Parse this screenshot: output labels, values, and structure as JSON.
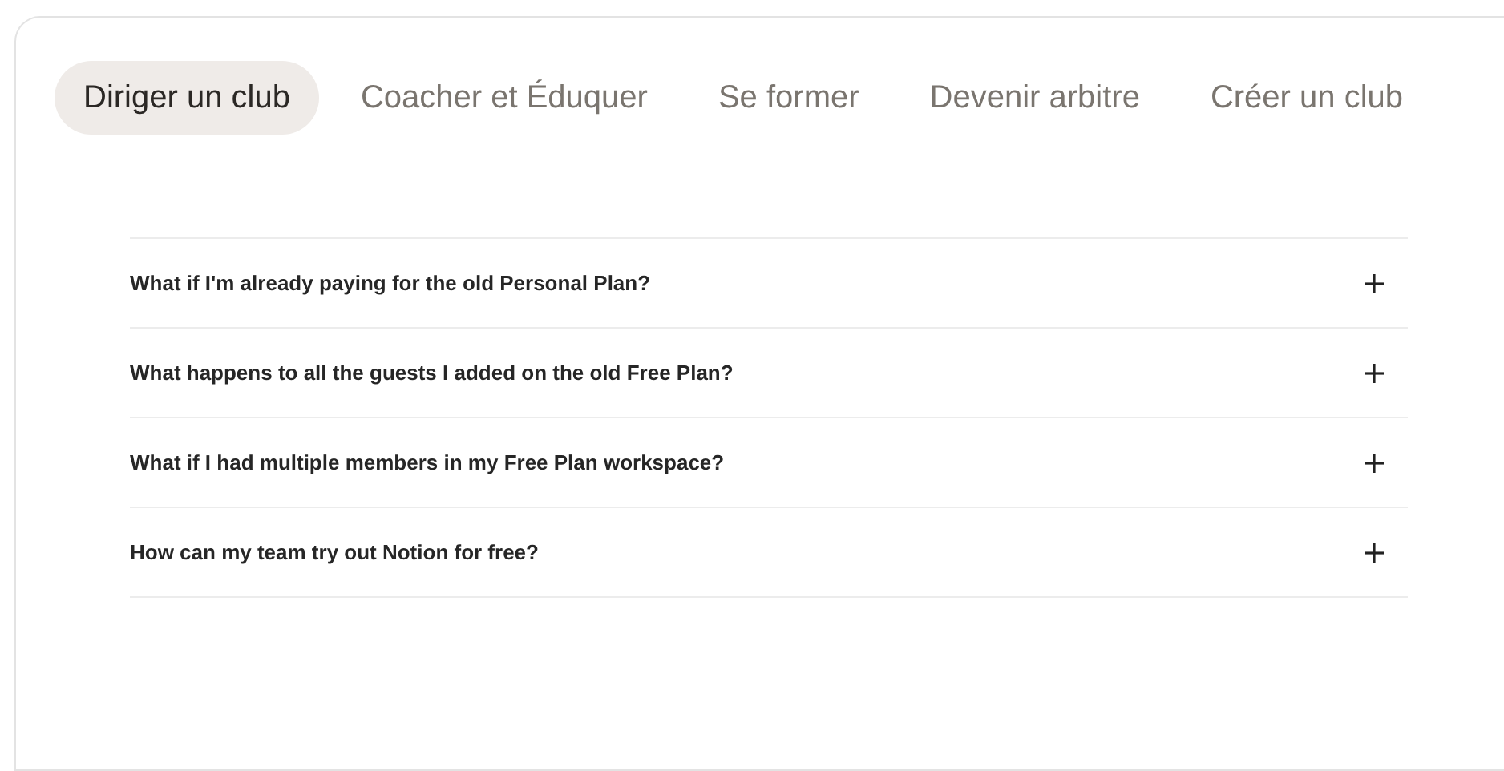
{
  "tabs": [
    {
      "label": "Diriger un club",
      "selected": true
    },
    {
      "label": "Coacher et Éduquer",
      "selected": false
    },
    {
      "label": "Se former",
      "selected": false
    },
    {
      "label": "Devenir arbitre",
      "selected": false
    },
    {
      "label": "Créer un club",
      "selected": false
    }
  ],
  "faq": [
    {
      "question": "What if I'm already paying for the old Personal Plan?",
      "expanded": false
    },
    {
      "question": "What happens to all the guests I added on the old Free Plan?",
      "expanded": false
    },
    {
      "question": "What if I had multiple members in my Free Plan workspace?",
      "expanded": false
    },
    {
      "question": "How can my team try out Notion for free?",
      "expanded": false
    }
  ]
}
